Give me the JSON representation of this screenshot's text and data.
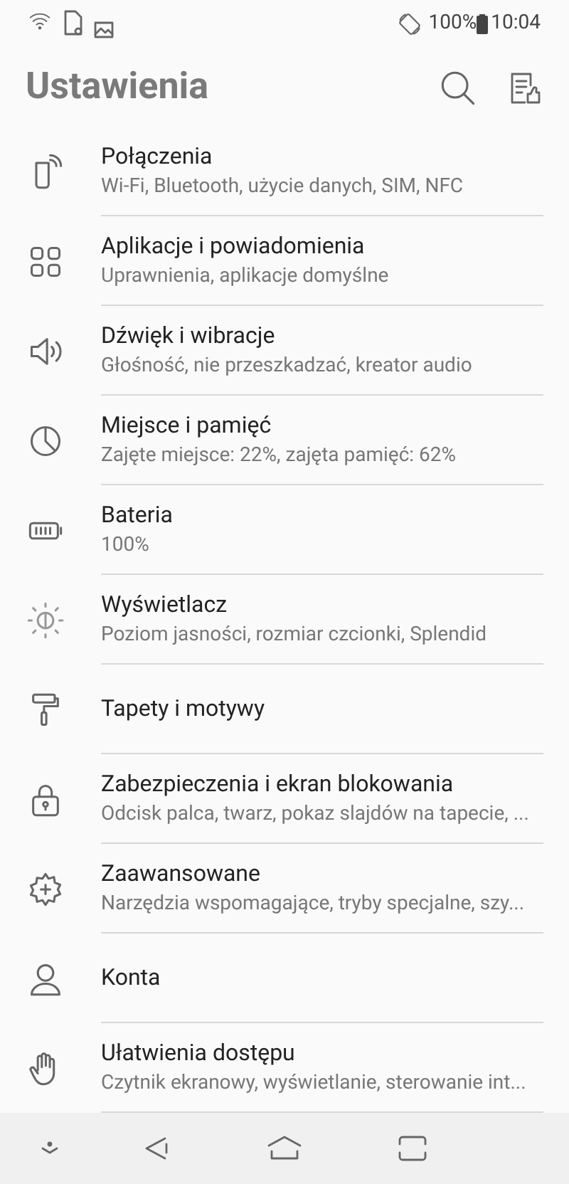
{
  "status_bar": {
    "battery": "100%",
    "time": "10:04"
  },
  "header": {
    "title": "Ustawienia"
  },
  "items": [
    {
      "title": "Połączenia",
      "subtitle": "Wi-Fi, Bluetooth, użycie danych, SIM, NFC"
    },
    {
      "title": "Aplikacje i powiadomienia",
      "subtitle": "Uprawnienia, aplikacje domyślne"
    },
    {
      "title": "Dźwięk i wibracje",
      "subtitle": "Głośność, nie przeszkadzać, kreator audio"
    },
    {
      "title": "Miejsce i pamięć",
      "subtitle": "Zajęte miejsce: 22%, zajęta pamięć: 62%"
    },
    {
      "title": "Bateria",
      "subtitle": "100%"
    },
    {
      "title": "Wyświetlacz",
      "subtitle": "Poziom jasności, rozmiar czcionki, Splendid"
    },
    {
      "title": "Tapety i motywy"
    },
    {
      "title": "Zabezpieczenia i ekran blokowania",
      "subtitle": "Odcisk palca, twarz, pokaz slajdów na tapecie, ..."
    },
    {
      "title": "Zaawansowane",
      "subtitle": "Narzędzia wspomagające, tryby specjalne, szy..."
    },
    {
      "title": "Konta"
    },
    {
      "title": "Ułatwienia dostępu",
      "subtitle": "Czytnik ekranowy, wyświetlanie, sterowanie int..."
    }
  ]
}
